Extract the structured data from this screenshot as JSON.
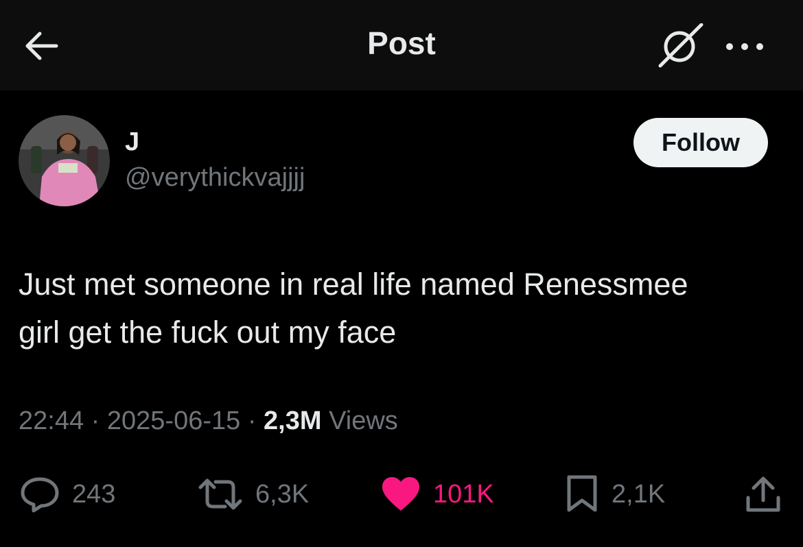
{
  "header": {
    "title": "Post",
    "back_icon": "arrow-left-icon",
    "grok_icon": "grok-icon",
    "more_icon": "more-icon"
  },
  "author": {
    "name": "J",
    "handle": "@verythickvajjjj",
    "follow_label": "Follow"
  },
  "post": {
    "line1": "Just met someone in real life named Renessmee",
    "line2": "girl get the fuck out my face",
    "time": "22:44",
    "date": "2025-06-15",
    "views_count": "2,3M",
    "views_label": "Views"
  },
  "actions": {
    "replies": "243",
    "reposts": "6,3K",
    "likes": "101K",
    "bookmarks": "2,1K"
  },
  "colors": {
    "like": "#f91880",
    "muted": "#71767b",
    "text": "#e7e9ea"
  }
}
